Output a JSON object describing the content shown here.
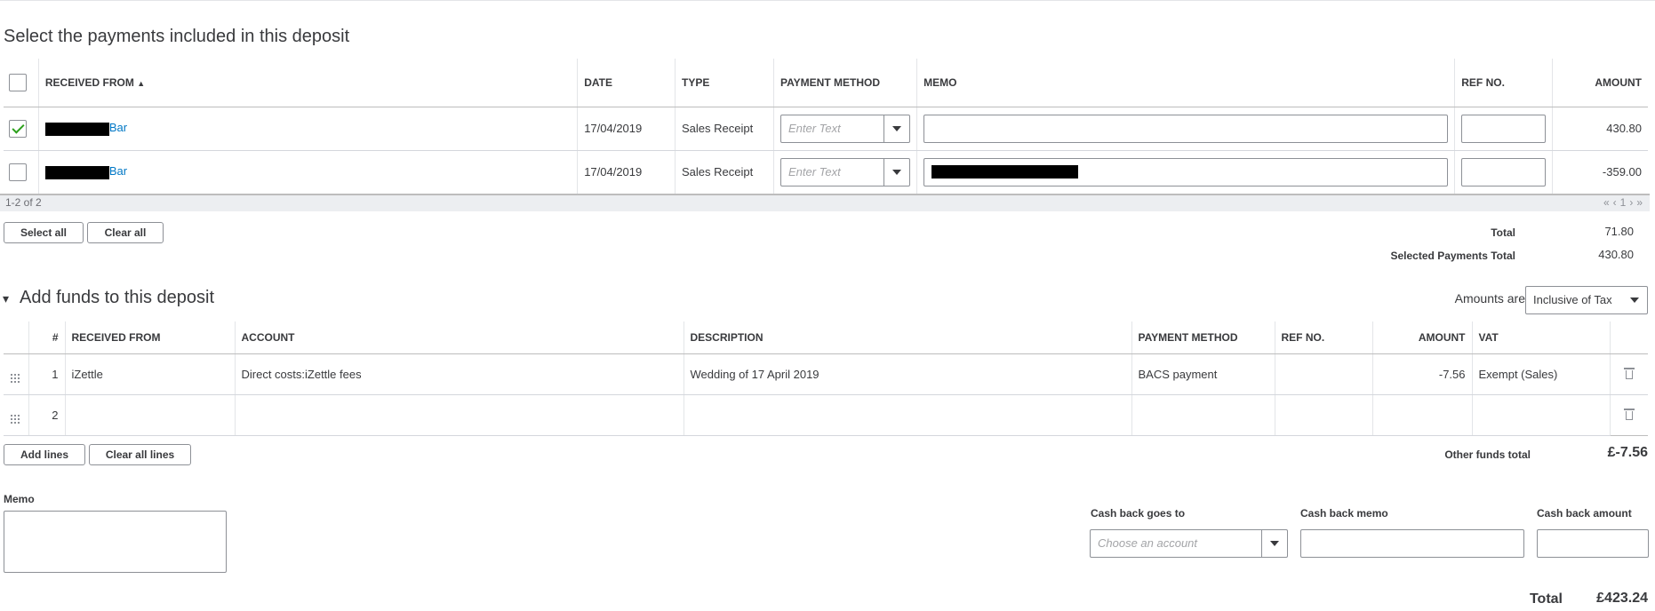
{
  "payments": {
    "title": "Select the payments included in this deposit",
    "columns": [
      "RECEIVED FROM",
      "DATE",
      "TYPE",
      "PAYMENT METHOD",
      "MEMO",
      "REF NO.",
      "AMOUNT"
    ],
    "rows": [
      {
        "checked": true,
        "received_suffix": "Bar",
        "date": "17/04/2019",
        "type": "Sales Receipt",
        "method_placeholder": "Enter Text",
        "amount": "430.80"
      },
      {
        "checked": false,
        "received_suffix": "Bar",
        "date": "17/04/2019",
        "type": "Sales Receipt",
        "method_placeholder": "Enter Text",
        "amount": "-359.00"
      }
    ],
    "pager_text": "1-2 of 2",
    "pager_page": "1",
    "pager_first": "«",
    "pager_prev": "‹",
    "pager_next": "›",
    "pager_last": "»",
    "select_all": "Select all",
    "clear_all": "Clear all",
    "total_label": "Total",
    "total_value": "71.80",
    "selected_label": "Selected Payments Total",
    "selected_value": "430.80"
  },
  "funds": {
    "toggle": "▾",
    "title": "Add funds to this deposit",
    "amounts_are_label": "Amounts are",
    "amounts_are_value": "Inclusive of Tax",
    "columns": [
      "#",
      "RECEIVED FROM",
      "ACCOUNT",
      "DESCRIPTION",
      "PAYMENT METHOD",
      "REF NO.",
      "AMOUNT",
      "VAT"
    ],
    "rows": [
      {
        "num": "1",
        "received_from": "iZettle",
        "account": "Direct costs:iZettle fees",
        "description": "Wedding of 17 April 2019",
        "payment_method": "BACS payment",
        "ref_no": "",
        "amount": "-7.56",
        "vat": "Exempt (Sales)"
      },
      {
        "num": "2",
        "received_from": "",
        "account": "",
        "description": "",
        "payment_method": "",
        "ref_no": "",
        "amount": "",
        "vat": ""
      }
    ],
    "add_lines": "Add lines",
    "clear_all_lines": "Clear all lines",
    "other_total_label": "Other funds total",
    "other_total_value": "£-7.56"
  },
  "footer": {
    "memo_label": "Memo",
    "cashback_to_label": "Cash back goes to",
    "cashback_to_placeholder": "Choose an account",
    "cashback_memo_label": "Cash back memo",
    "cashback_amount_label": "Cash back amount",
    "total_label": "Total",
    "total_value": "£423.24"
  },
  "colors": {
    "accent_green": "#2ca01c",
    "link_blue": "#0077c5",
    "text": "#393a3d"
  }
}
